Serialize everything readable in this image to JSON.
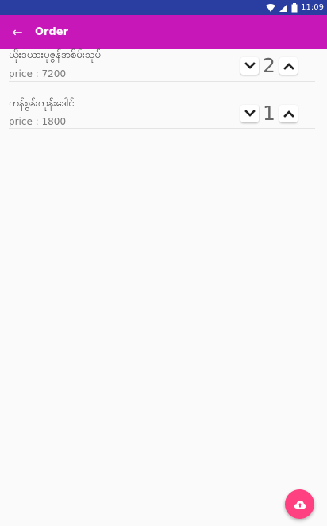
{
  "status_bar": {
    "time": "11:09",
    "icons": [
      "wifi-icon",
      "signal-icon",
      "battery-icon"
    ]
  },
  "app_bar": {
    "back_icon": "back-arrow-icon",
    "title": "Order"
  },
  "orders": [
    {
      "name": "ယိုးဒယားပုဇွန်အစိမ်းသုပ်",
      "price": "price : 7200",
      "quantity": "2",
      "decrement_icon": "chevron-down-icon",
      "increment_icon": "chevron-up-icon"
    },
    {
      "name": "ကန်စွန်းကုန်းဒေါင်",
      "price": "price : 1800",
      "quantity": "1",
      "decrement_icon": "chevron-down-icon",
      "increment_icon": "chevron-up-icon"
    }
  ],
  "fab": {
    "icon": "cloud-upload-icon"
  },
  "colors": {
    "status_bar": "#2a3da1",
    "app_bar": "#c817b8",
    "fab": "#ff4081",
    "background": "#fafafa"
  }
}
